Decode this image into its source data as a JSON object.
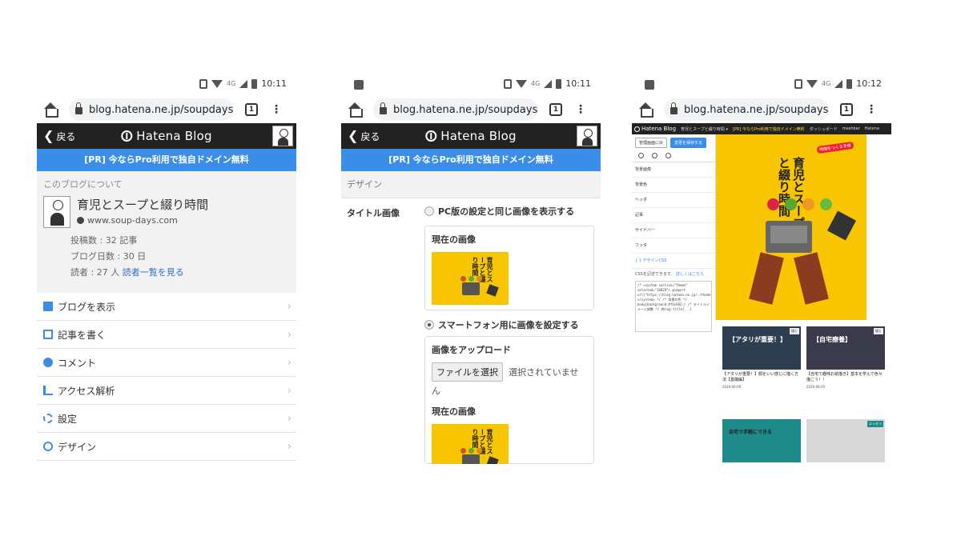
{
  "status": {
    "p1_time": "10:11",
    "p2_time": "10:11",
    "p3_time": "10:12",
    "network": "4G"
  },
  "browser": {
    "url_p1": "blog.hatena.ne.jp/soupdays/s",
    "url_p2": "blog.hatena.ne.jp/soupdays/s",
    "url_p3": "blog.hatena.ne.jp/soupdays/s",
    "tab_count": "1",
    "menu_glyph": "⋮",
    "icons": [
      "home-icon",
      "lock-icon",
      "tabs-icon",
      "menu-icon"
    ]
  },
  "hatena": {
    "back_label": "戻る",
    "back_glyph": "❮",
    "logo_text": "Hatena Blog",
    "pr_banner": "[PR] 今ならPro利用で独自ドメイン無料",
    "accent_color": "#3b8ee8",
    "header_color": "#222222"
  },
  "phone1": {
    "about_title": "このブログについて",
    "blog_name": "育児とスープと綴り時間",
    "blog_url": "www.soup-days.com",
    "posts": "投稿数 : 32 記事",
    "days": "ブログ日数 : 30 日",
    "readers_prefix": "読者 : 27 人 ",
    "readers_link": "読者一覧を見る",
    "chevron": "›",
    "menu": [
      {
        "label": "ブログを表示",
        "icon": "blog-icon"
      },
      {
        "label": "記事を書く",
        "icon": "write-icon"
      },
      {
        "label": "コメント",
        "icon": "comment-icon"
      },
      {
        "label": "アクセス解析",
        "icon": "analytics-icon"
      },
      {
        "label": "設定",
        "icon": "settings-icon"
      },
      {
        "label": "デザイン",
        "icon": "design-icon"
      }
    ]
  },
  "phone2": {
    "section": "デザイン",
    "title_image_label": "タイトル画像",
    "option_pc": "PC版の設定と同じ画像を表示する",
    "current_image": "現在の画像",
    "option_sp": "スマートフォン用に画像を設定する",
    "upload_title": "画像をアップロード",
    "file_button": "ファイルを選択",
    "file_note": "選択されていません",
    "current_image_2": "現在の画像",
    "thumb_title": "育児とスープと綴り時間"
  },
  "phone3": {
    "logo": "Hatena Blog",
    "nav_links": [
      "育児とスープと綴り時間 ▾",
      "ダッシュボード",
      "mashbar",
      "Hatena"
    ],
    "pr_text": "[PR] 今ならPro利用で独自ドメイン無料",
    "btn_back": "管理画面に戻",
    "btn_save": "変更を保存する",
    "side_items": [
      "背景画像",
      "背景色",
      "ヘッダ",
      "記事",
      "サイドバー",
      "フッタ",
      "{ } デザインCSS"
    ],
    "css_note": "CSSを記述できます。",
    "css_link": "詳しくはこちら",
    "css_code": "/* <system section=\"theme\" selected=\"16028\"> @import url(\"https://blog.hatena.ne.jp/-/theme\") </system> */ /* 背景の色 */ body{background:#f6c602;} /* タイトルイメージ調整 */ #blog-title{...}",
    "hero_title": "育児とスープと綴り時間",
    "hero_badge": "時間をつくる手帳",
    "cards": [
      {
        "img_text": "【アタリが重要！】",
        "title": "【アタリが重要！】顔をいい感じに描く方法【基礎編】",
        "date": "2020-06-06",
        "tag": "描く"
      },
      {
        "img_text": "【自宅療養】",
        "title": "【自宅で趣味お絵描き】基本を学んで色々描こう！！",
        "date": "2020-06-05",
        "tag": "描く"
      },
      {
        "img_text": "自宅で手軽にできる",
        "title": "",
        "date": "",
        "tag": ""
      },
      {
        "img_text": "",
        "title": "",
        "date": "",
        "tag": "エッセイ"
      }
    ]
  }
}
